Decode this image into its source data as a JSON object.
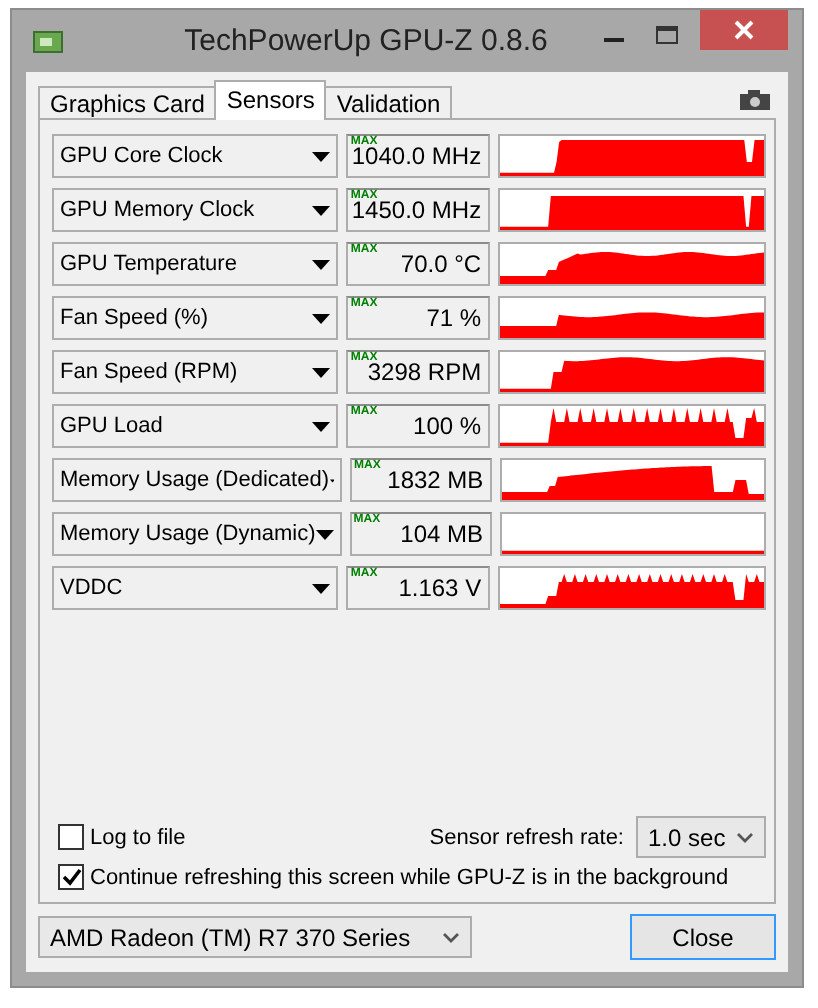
{
  "window": {
    "title": "TechPowerUp GPU-Z 0.8.6"
  },
  "tabs": [
    {
      "label": "Graphics Card",
      "selected": false
    },
    {
      "label": "Sensors",
      "selected": true
    },
    {
      "label": "Validation",
      "selected": false
    }
  ],
  "sensors": [
    {
      "name": "GPU Core Clock",
      "max_label": "MAX",
      "value": "1040.0 MHz"
    },
    {
      "name": "GPU Memory Clock",
      "max_label": "MAX",
      "value": "1450.0 MHz"
    },
    {
      "name": "GPU Temperature",
      "max_label": "MAX",
      "value": "70.0 °C"
    },
    {
      "name": "Fan Speed (%)",
      "max_label": "MAX",
      "value": "71 %"
    },
    {
      "name": "Fan Speed (RPM)",
      "max_label": "MAX",
      "value": "3298 RPM"
    },
    {
      "name": "GPU Load",
      "max_label": "MAX",
      "value": "100 %"
    },
    {
      "name": "Memory Usage (Dedicated)",
      "max_label": "MAX",
      "value": "1832 MB"
    },
    {
      "name": "Memory Usage (Dynamic)",
      "max_label": "MAX",
      "value": "104 MB"
    },
    {
      "name": "VDDC",
      "max_label": "MAX",
      "value": "1.163 V"
    }
  ],
  "options": [
    {
      "label": "Log to file",
      "checked": false
    },
    {
      "label": "Continue refreshing this screen while GPU-Z is in the background",
      "checked": true
    }
  ],
  "refresh_rate": {
    "label": "Sensor refresh rate:",
    "value": "1.0 sec"
  },
  "gpu_select": {
    "value": "AMD Radeon (TM) R7 370 Series"
  },
  "close_button": {
    "label": "Close"
  }
}
